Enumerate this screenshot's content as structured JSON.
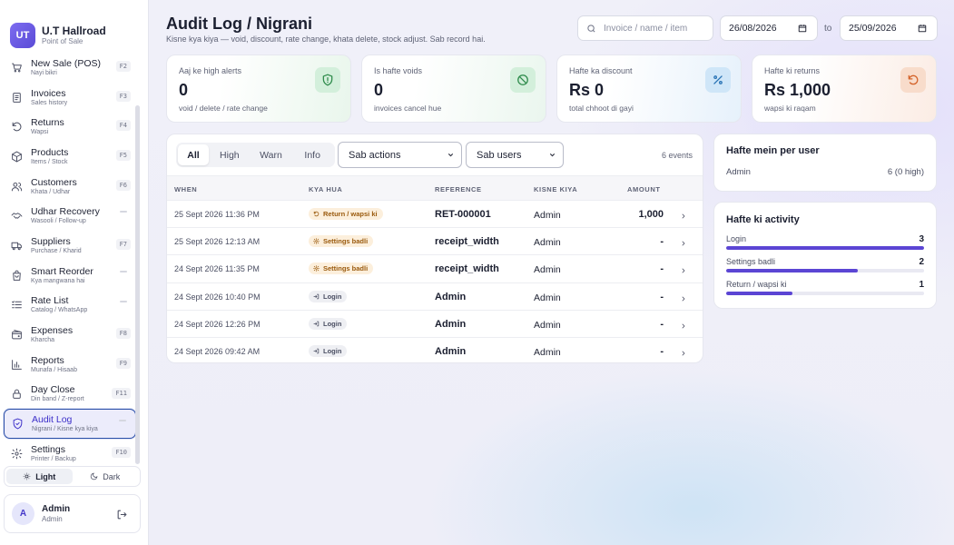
{
  "brand": {
    "logo": "UT",
    "name": "U.T Hallroad",
    "subtitle": "Point of Sale"
  },
  "nav": [
    {
      "id": "new-sale",
      "icon": "cart-icon",
      "label": "New Sale (POS)",
      "sub": "Nayi bikri",
      "key": "F2"
    },
    {
      "id": "invoices",
      "icon": "invoice-icon",
      "label": "Invoices",
      "sub": "Sales history",
      "key": "F3"
    },
    {
      "id": "returns",
      "icon": "undo-icon",
      "label": "Returns",
      "sub": "Wapsi",
      "key": "F4"
    },
    {
      "id": "products",
      "icon": "box-icon",
      "label": "Products",
      "sub": "Items / Stock",
      "key": "F5"
    },
    {
      "id": "customers",
      "icon": "users-icon",
      "label": "Customers",
      "sub": "Khata / Udhar",
      "key": "F6"
    },
    {
      "id": "udhar-recovery",
      "icon": "handshake-icon",
      "label": "Udhar Recovery",
      "sub": "Wasooli / Follow-up",
      "key": ""
    },
    {
      "id": "suppliers",
      "icon": "truck-icon",
      "label": "Suppliers",
      "sub": "Purchase / Kharid",
      "key": "F7"
    },
    {
      "id": "smart-reorder",
      "icon": "bag-icon",
      "label": "Smart Reorder",
      "sub": "Kya mangwana hai",
      "key": ""
    },
    {
      "id": "rate-list",
      "icon": "list-icon",
      "label": "Rate List",
      "sub": "Catalog / WhatsApp",
      "key": ""
    },
    {
      "id": "expenses",
      "icon": "wallet-icon",
      "label": "Expenses",
      "sub": "Kharcha",
      "key": "F8"
    },
    {
      "id": "reports",
      "icon": "chart-icon",
      "label": "Reports",
      "sub": "Munafa / Hisaab",
      "key": "F9"
    },
    {
      "id": "day-close",
      "icon": "lock-icon",
      "label": "Day Close",
      "sub": "Din band / Z-report",
      "key": "F11"
    },
    {
      "id": "audit-log",
      "icon": "shield-icon",
      "label": "Audit Log",
      "sub": "Nigrani / Kisne kya kiya",
      "key": "",
      "active": true
    },
    {
      "id": "settings",
      "icon": "gear-icon",
      "label": "Settings",
      "sub": "Printer / Backup",
      "key": "F10"
    }
  ],
  "theme": {
    "light": "Light",
    "dark": "Dark"
  },
  "user": {
    "initial": "A",
    "name": "Admin",
    "role": "Admin"
  },
  "header": {
    "title": "Audit Log / Nigrani",
    "subtitle": "Kisne kya kiya — void, discount, rate change, khata delete, stock adjust. Sab record hai.",
    "search_placeholder": "Invoice / name / item",
    "date_from": "26/08/2026",
    "date_sep": "to",
    "date_to": "25/09/2026"
  },
  "stats": [
    {
      "label": "Aaj ke high alerts",
      "value": "0",
      "sub": "void / delete / rate change",
      "icon": "shield-alert-icon",
      "tone": "green"
    },
    {
      "label": "Is hafte voids",
      "value": "0",
      "sub": "invoices cancel hue",
      "icon": "ban-icon",
      "tone": "red"
    },
    {
      "label": "Hafte ka discount",
      "value": "Rs 0",
      "sub": "total chhoot di gayi",
      "icon": "percent-icon",
      "tone": "blue"
    },
    {
      "label": "Hafte ki returns",
      "value": "Rs 1,000",
      "sub": "wapsi ki raqam",
      "icon": "undo-icon",
      "tone": "orange"
    }
  ],
  "filters": {
    "tabs": [
      "All",
      "High",
      "Warn",
      "Info"
    ],
    "active_tab": "All",
    "action_select": "Sab actions",
    "user_select": "Sab users",
    "events": "6 events"
  },
  "table": {
    "columns": [
      "WHEN",
      "KYA HUA",
      "REFERENCE",
      "KISNE KIYA",
      "AMOUNT"
    ],
    "rows": [
      {
        "when": "25 Sept 2026 11:36 PM",
        "what": "Return / wapsi ki",
        "kind": "warn",
        "icon": "undo-icon",
        "ref": "RET-000001",
        "who": "Admin",
        "amount": "1,000"
      },
      {
        "when": "25 Sept 2026 12:13 AM",
        "what": "Settings badli",
        "kind": "warn",
        "icon": "gear-icon",
        "ref": "receipt_width",
        "who": "Admin",
        "amount": "-"
      },
      {
        "when": "24 Sept 2026 11:35 PM",
        "what": "Settings badli",
        "kind": "warn",
        "icon": "gear-icon",
        "ref": "receipt_width",
        "who": "Admin",
        "amount": "-"
      },
      {
        "when": "24 Sept 2026 10:40 PM",
        "what": "Login",
        "kind": "info",
        "icon": "login-icon",
        "ref": "Admin",
        "who": "Admin",
        "amount": "-"
      },
      {
        "when": "24 Sept 2026 12:26 PM",
        "what": "Login",
        "kind": "info",
        "icon": "login-icon",
        "ref": "Admin",
        "who": "Admin",
        "amount": "-"
      },
      {
        "when": "24 Sept 2026 09:42 AM",
        "what": "Login",
        "kind": "info",
        "icon": "login-icon",
        "ref": "Admin",
        "who": "Admin",
        "amount": "-"
      }
    ]
  },
  "per_user": {
    "title": "Hafte mein per user",
    "rows": [
      {
        "name": "Admin",
        "value": "6 (0 high)"
      }
    ]
  },
  "activity": {
    "title": "Hafte ki activity",
    "items": [
      {
        "label": "Login",
        "count": 3,
        "fraction": 1.0
      },
      {
        "label": "Settings badli",
        "count": 2,
        "fraction": 0.667
      },
      {
        "label": "Return / wapsi ki",
        "count": 1,
        "fraction": 0.333
      }
    ]
  },
  "colors": {
    "accent": "#5b45d4",
    "active_border": "#2b4fa8",
    "warn_bg": "#fcefdc",
    "warn_text": "#9a5a0d"
  }
}
